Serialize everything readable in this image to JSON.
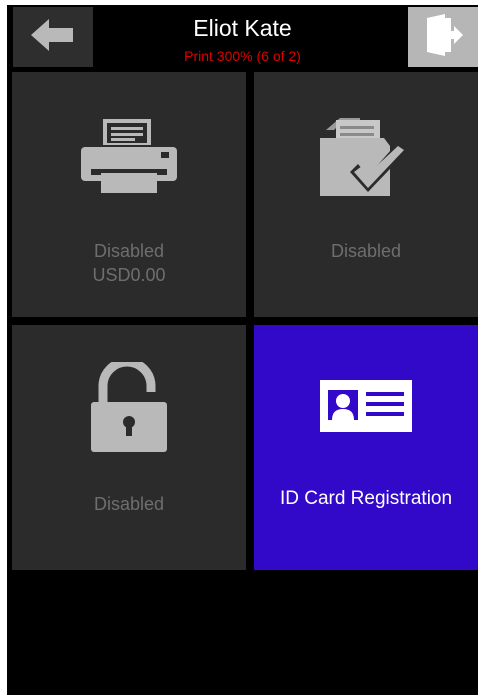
{
  "header": {
    "user_name": "Eliot Kate",
    "quota_status": "Print 300% (6 of 2)",
    "back_icon": "arrow-left-icon",
    "logout_icon": "door-exit-icon"
  },
  "tiles": [
    {
      "icon": "printer-icon",
      "label": "Disabled",
      "sublabel": "USD0.00",
      "active": false
    },
    {
      "icon": "folder-check-icon",
      "label": "Disabled",
      "active": false
    },
    {
      "icon": "unlocked-padlock-icon",
      "label": "Disabled",
      "active": false
    },
    {
      "icon": "id-card-icon",
      "label": "ID Card Registration",
      "active": true
    }
  ],
  "colors": {
    "background": "#000000",
    "tile": "#2b2b2b",
    "tile_active": "#3309c9",
    "tile_disabled_text": "#6e6e6e",
    "quota_text": "#e00000",
    "logout_button": "#b6b6b6"
  }
}
